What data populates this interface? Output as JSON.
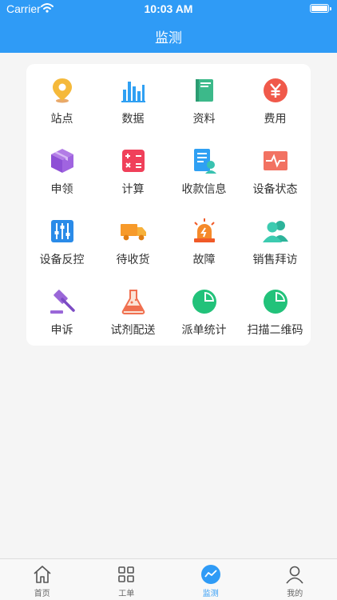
{
  "status_bar": {
    "carrier": "Carrier",
    "time": "10:03 AM"
  },
  "header": {
    "title": "监测"
  },
  "grid": {
    "items": [
      {
        "label": "站点",
        "icon": "location-pin-icon"
      },
      {
        "label": "数据",
        "icon": "bar-chart-icon"
      },
      {
        "label": "资料",
        "icon": "book-icon"
      },
      {
        "label": "费用",
        "icon": "yuan-coin-icon"
      },
      {
        "label": "申领",
        "icon": "package-box-icon"
      },
      {
        "label": "计算",
        "icon": "calculator-icon"
      },
      {
        "label": "收款信息",
        "icon": "payment-doc-icon"
      },
      {
        "label": "设备状态",
        "icon": "heartbeat-monitor-icon"
      },
      {
        "label": "设备反控",
        "icon": "sliders-icon"
      },
      {
        "label": "待收货",
        "icon": "delivery-truck-icon"
      },
      {
        "label": "故障",
        "icon": "alarm-light-icon"
      },
      {
        "label": "销售拜访",
        "icon": "users-icon"
      },
      {
        "label": "申诉",
        "icon": "gavel-icon"
      },
      {
        "label": "试剂配送",
        "icon": "flask-icon"
      },
      {
        "label": "派单统计",
        "icon": "pie-chart-icon"
      },
      {
        "label": "扫描二维码",
        "icon": "pie-chart-icon"
      }
    ]
  },
  "tabbar": {
    "tabs": [
      {
        "label": "首页",
        "icon": "home-icon"
      },
      {
        "label": "工单",
        "icon": "grid-icon"
      },
      {
        "label": "监测",
        "icon": "trend-icon",
        "active": true
      },
      {
        "label": "我的",
        "icon": "user-icon"
      }
    ]
  },
  "colors": {
    "primary": "#2f9bf6",
    "background": "#f5f5f5"
  }
}
